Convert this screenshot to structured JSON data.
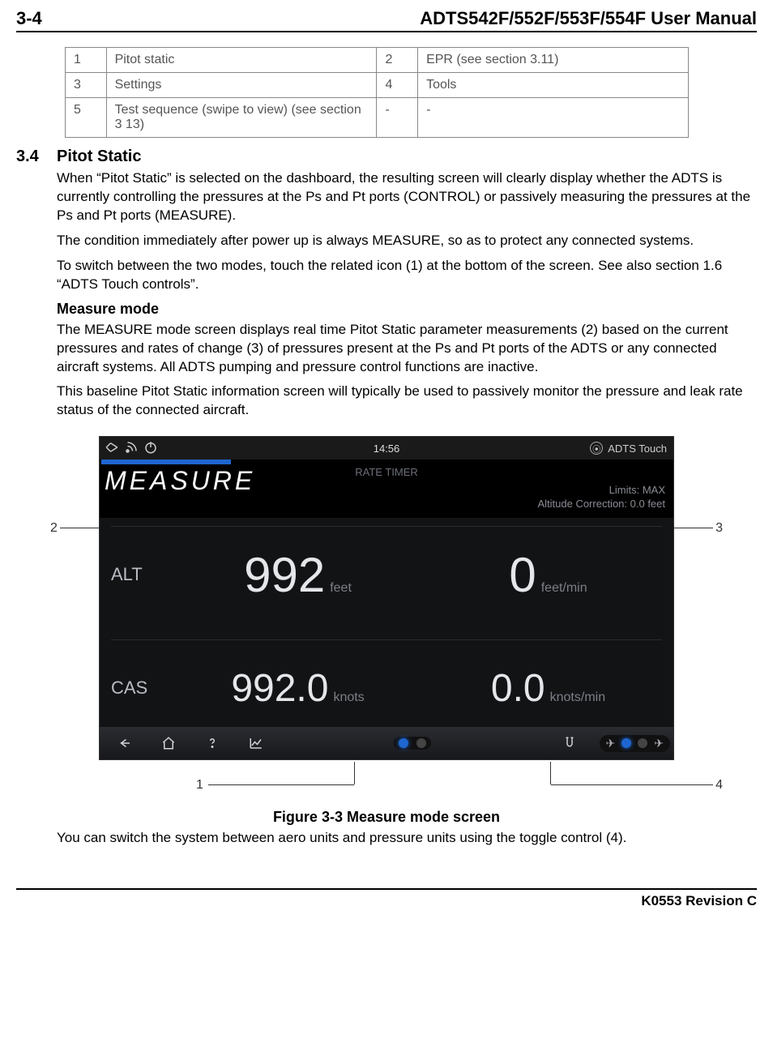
{
  "header": {
    "page_number": "3-4",
    "manual_title": "ADTS542F/552F/553F/554F User Manual"
  },
  "legend": {
    "rows": [
      {
        "n1": "1",
        "l1": "Pitot static",
        "n2": "2",
        "l2": "EPR (see section 3.11)"
      },
      {
        "n1": "3",
        "l1": "Settings",
        "n2": "4",
        "l2": "Tools"
      },
      {
        "n1": "5",
        "l1": "Test sequence (swipe to view) (see section 3 13)",
        "n2": "-",
        "l2": "-"
      }
    ]
  },
  "section": {
    "num": "3.4",
    "title": "Pitot Static",
    "p1": "When “Pitot Static” is selected on the dashboard, the resulting screen will clearly display whether the ADTS is currently controlling the pressures at the Ps and Pt ports (CONTROL) or passively measuring the pressures at the Ps and Pt ports (MEASURE).",
    "p2": "The condition immediately after power up is always MEASURE, so as to protect any connected systems.",
    "p3": "To switch between the two modes, touch the related icon (1) at the bottom of the screen. See also section 1.6 “ADTS Touch controls”.",
    "sub_heading": "Measure mode",
    "p4": "The MEASURE mode screen displays real time Pitot Static parameter measurements (2) based on the current pressures and rates of change (3) of pressures present at the Ps and Pt ports of the ADTS or any connected aircraft systems. All ADTS pumping and pressure control functions are inactive.",
    "p5": "This baseline Pitot Static information screen will typically be used to passively monitor the pressure and leak rate status of the connected aircraft."
  },
  "callouts": {
    "c1": "1",
    "c2": "2",
    "c3": "3",
    "c4": "4"
  },
  "device": {
    "clock": "14:56",
    "brand": "ADTS Touch",
    "rate_timer": "RATE TIMER",
    "mode_label": "MEASURE",
    "limits_line1": "Limits: MAX",
    "limits_line2": "Altitude Correction: 0.0 feet",
    "alt_label": "ALT",
    "alt_value": "992",
    "alt_unit": "feet",
    "alt_rate_value": "0",
    "alt_rate_unit": "feet/min",
    "cas_label": "CAS",
    "cas_value": "992.0",
    "cas_unit": "knots",
    "cas_rate_value": "0.0",
    "cas_rate_unit": "knots/min"
  },
  "figure": {
    "caption": "Figure 3-3 Measure mode screen",
    "after_text": "You can switch the system between aero units and pressure units using the toggle control (4)."
  },
  "footer": {
    "rev": "K0553 Revision C"
  }
}
